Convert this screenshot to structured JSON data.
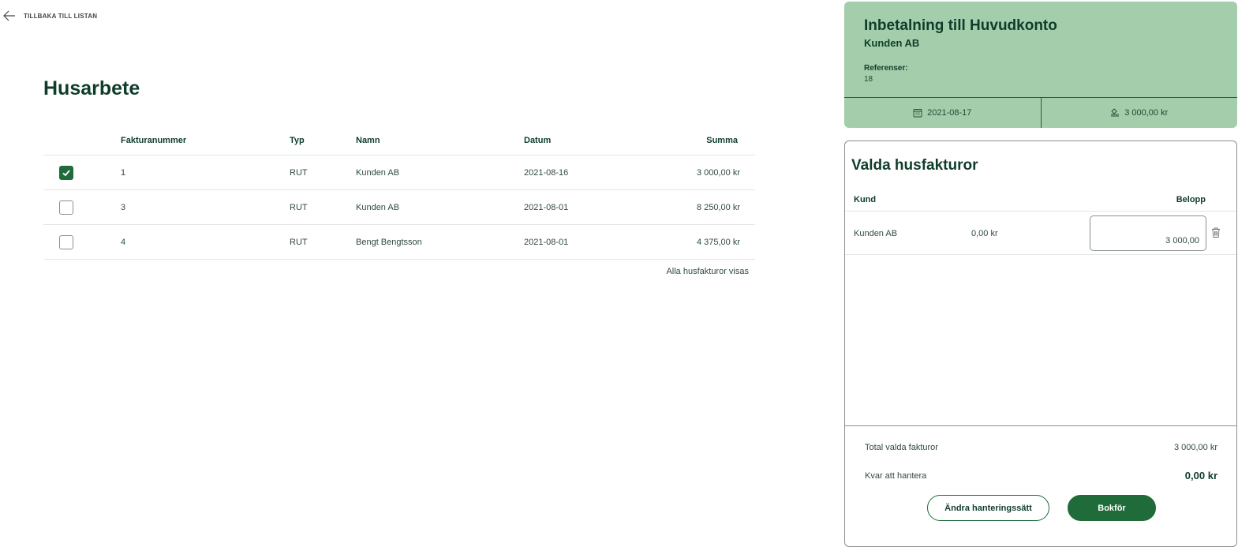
{
  "back": {
    "label": "TILLBAKA TILL LISTAN"
  },
  "page_title": "Husarbete",
  "invoice_table": {
    "headers": {
      "number": "Fakturanummer",
      "type": "Typ",
      "name": "Namn",
      "date": "Datum",
      "sum": "Summa"
    },
    "rows": [
      {
        "checked": true,
        "number": "1",
        "type": "RUT",
        "name": "Kunden AB",
        "date": "2021-08-16",
        "sum": "3 000,00 kr"
      },
      {
        "checked": false,
        "number": "3",
        "type": "RUT",
        "name": "Kunden AB",
        "date": "2021-08-01",
        "sum": "8 250,00 kr"
      },
      {
        "checked": false,
        "number": "4",
        "type": "RUT",
        "name": "Bengt Bengtsson",
        "date": "2021-08-01",
        "sum": "4 375,00 kr"
      }
    ],
    "footer_note": "Alla husfakturor visas"
  },
  "payment": {
    "title": "Inbetalning till Huvudkonto",
    "customer": "Kunden AB",
    "references_label": "Referenser:",
    "references_value": "18",
    "date": "2021-08-17",
    "amount": "3 000,00 kr",
    "date_icon": "calendar-icon",
    "amount_icon": "coins-icon",
    "background_color": "#a4cdab"
  },
  "selected": {
    "title": "Valda husfakturor",
    "headers": {
      "customer": "Kund",
      "amount": "Belopp"
    },
    "rows": [
      {
        "customer": "Kunden AB",
        "remaining": "0,00 kr",
        "amount_value": "3 000,00"
      }
    ],
    "total_label": "Total valda fakturor",
    "total_value": "3 000,00 kr",
    "remaining_label": "Kvar att hantera",
    "remaining_value": "0,00 kr",
    "change_button": "Ändra hanteringssätt",
    "book_button": "Bokför"
  },
  "colors": {
    "primary": "#1f6b3a",
    "text": "#0f3d2a"
  }
}
